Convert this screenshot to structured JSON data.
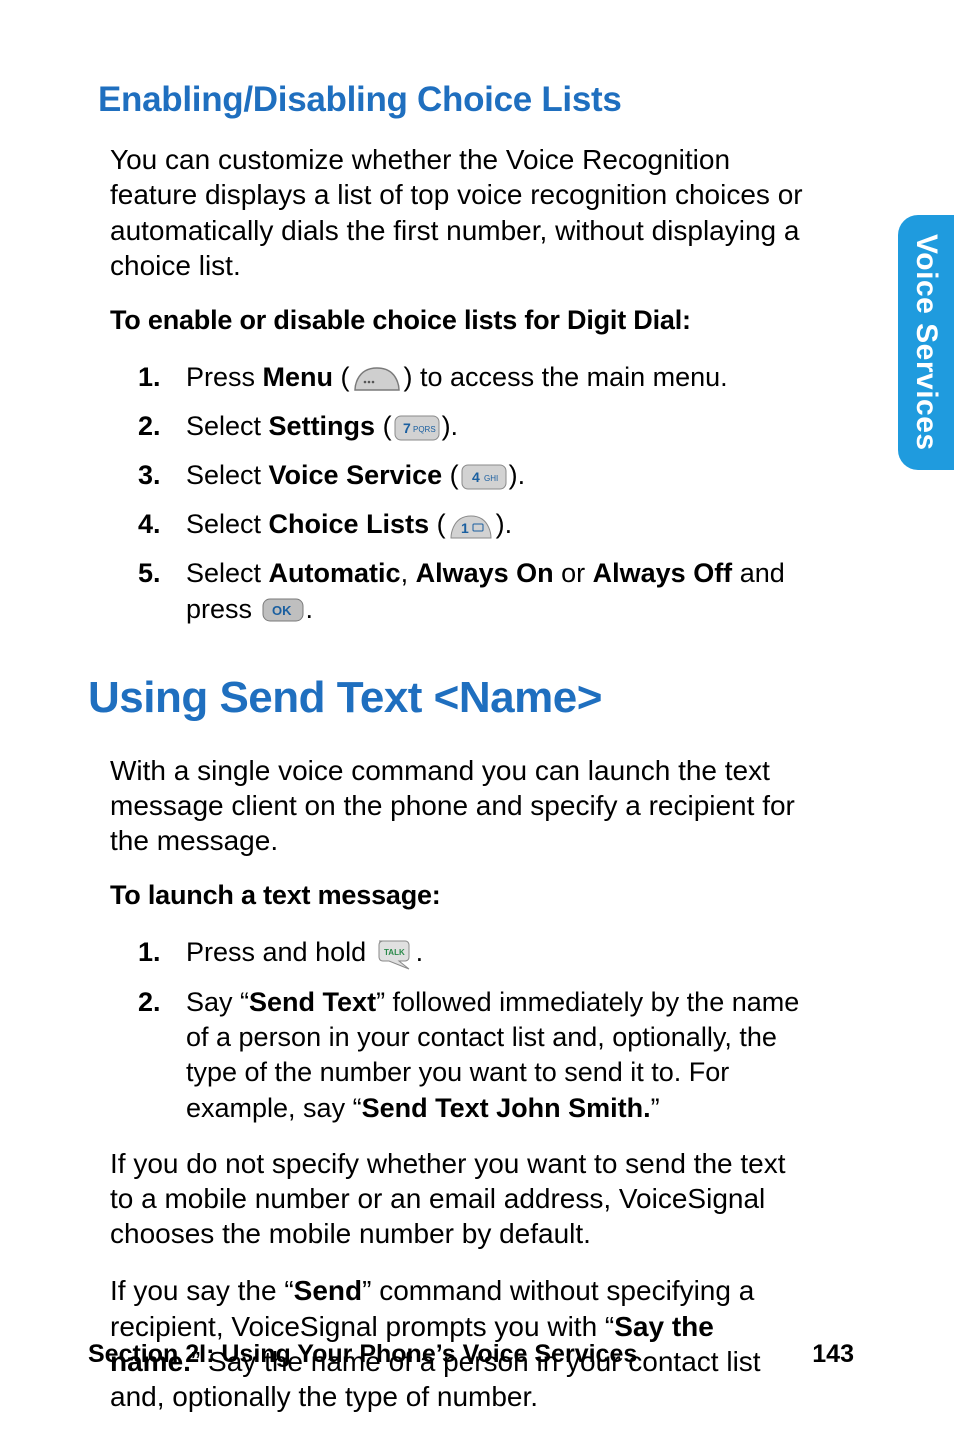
{
  "sideTab": {
    "label": "Voice Services"
  },
  "section1": {
    "heading": "Enabling/Disabling Choice Lists",
    "intro": "You can customize whether the Voice Recognition feature displays a list of top voice recognition choices or automatically dials the first number, without displaying a choice list.",
    "lead": "To enable or disable choice lists for Digit Dial:",
    "steps": {
      "s1": {
        "num": "1.",
        "t1": "Press ",
        "b1": "Menu",
        "t2": " (",
        "t3": ") to access the main menu."
      },
      "s2": {
        "num": "2.",
        "t1": "Select ",
        "b1": "Settings",
        "t2": " (",
        "t3": ")."
      },
      "s3": {
        "num": "3.",
        "t1": "Select ",
        "b1": "Voice Service",
        "t2": " (",
        "t3": ")."
      },
      "s4": {
        "num": "4.",
        "t1": "Select ",
        "b1": "Choice Lists",
        "t2": " (",
        "t3": ")."
      },
      "s5": {
        "num": "5.",
        "t1": "Select ",
        "b1": "Automatic",
        "t2": ", ",
        "b2": "Always On",
        "t3": " or ",
        "b3": "Always Off",
        "t4": " and press ",
        "t5": "."
      }
    }
  },
  "section2": {
    "heading": "Using Send Text <Name>",
    "intro": "With a single voice command you can launch the text message client on the phone and specify a recipient for the message.",
    "lead": "To launch a text message:",
    "steps": {
      "s1": {
        "num": "1.",
        "t1": "Press and hold ",
        "t2": "."
      },
      "s2": {
        "num": "2.",
        "t1": "Say “",
        "b1": "Send Text",
        "t2": "” followed immediately by the name of a person in your contact list and, optionally, the type of the number you want to send it to. For example, say “",
        "b2": "Send Text John Smith.",
        "t3": "”"
      }
    },
    "para1a": "If you do not specify whether you want to send the text to a mobile number or an email address, VoiceSignal chooses the mobile number by default.",
    "para2": {
      "t1": "If you say the “",
      "b1": "Send",
      "t2": "” command without specifying a recipient, VoiceSignal prompts you with “",
      "b2": "Say the name.",
      "t3": "” Say the name of a person in your contact list and, optionally the type of number."
    }
  },
  "footer": {
    "left": "Section 2I: Using Your Phone’s Voice Services",
    "right": "143"
  }
}
